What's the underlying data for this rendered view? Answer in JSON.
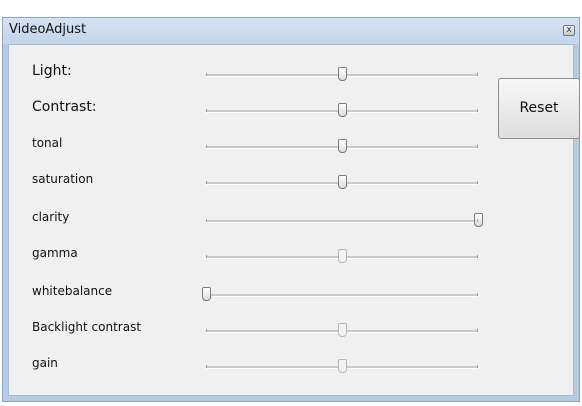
{
  "window": {
    "title": "VideoAdjust",
    "close_label": "x"
  },
  "reset_label": "Reset",
  "sliders": [
    {
      "label": "Light:",
      "value": 0.5,
      "enabled": true
    },
    {
      "label": "Contrast:",
      "value": 0.5,
      "enabled": true
    },
    {
      "label": "tonal",
      "value": 0.5,
      "enabled": true
    },
    {
      "label": "saturation",
      "value": 0.5,
      "enabled": true
    },
    {
      "label": "clarity",
      "value": 1.0,
      "enabled": true
    },
    {
      "label": "gamma",
      "value": 0.5,
      "enabled": false
    },
    {
      "label": "whitebalance",
      "value": 0.0,
      "enabled": true
    },
    {
      "label": "Backlight contrast",
      "value": 0.5,
      "enabled": false
    },
    {
      "label": "gain",
      "value": 0.5,
      "enabled": false
    }
  ]
}
